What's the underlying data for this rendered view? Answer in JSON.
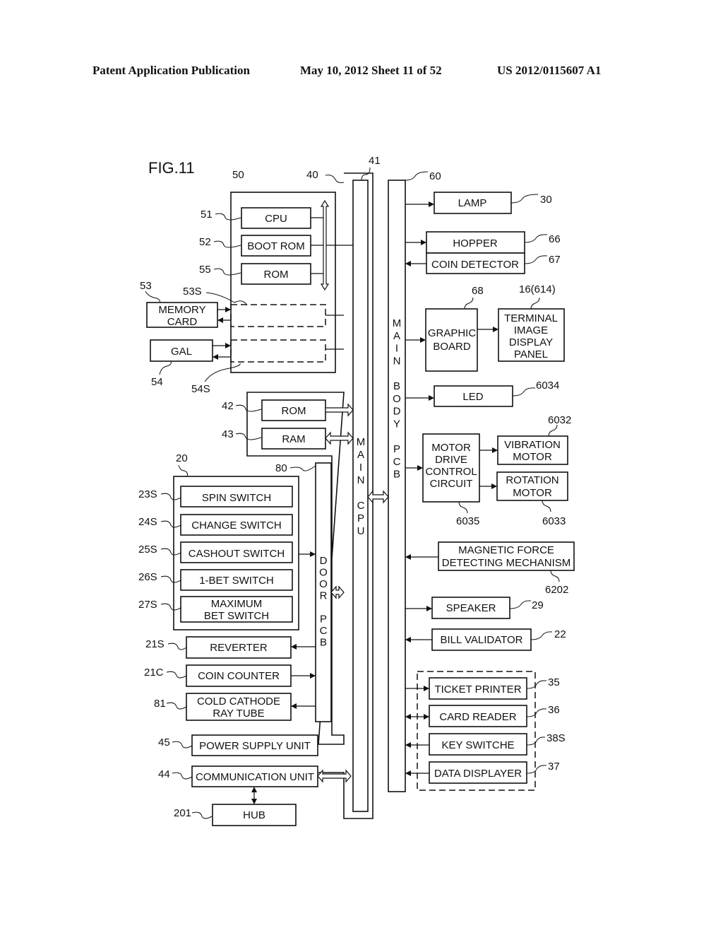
{
  "header": {
    "publication": "Patent Application Publication",
    "date_sheet": "May 10, 2012  Sheet 11 of 52",
    "number": "US 2012/0115607 A1"
  },
  "figure": {
    "title": "FIG.11",
    "refs": {
      "r50": "50",
      "r40": "40",
      "r41": "41",
      "r60": "60",
      "r51": "51",
      "r52": "52",
      "r55": "55",
      "r53": "53",
      "r53s": "53S",
      "r54": "54",
      "r54s": "54S",
      "r42": "42",
      "r43": "43",
      "r20": "20",
      "r80": "80",
      "r23s": "23S",
      "r24s": "24S",
      "r25s": "25S",
      "r26s": "26S",
      "r27s": "27S",
      "r21s": "21S",
      "r21c": "21C",
      "r81": "81",
      "r45": "45",
      "r44": "44",
      "r201": "201",
      "r30": "30",
      "r66": "66",
      "r67": "67",
      "r68": "68",
      "r16": "16(614)",
      "r6034": "6034",
      "r6032": "6032",
      "r6035": "6035",
      "r6033": "6033",
      "r6202": "6202",
      "r29": "29",
      "r22": "22",
      "r35": "35",
      "r36": "36",
      "r38s": "38S",
      "r37": "37"
    },
    "blocks": {
      "cpu": "CPU",
      "boot_rom": "BOOT ROM",
      "sub_rom": "ROM",
      "memory_card": [
        "MEMORY",
        "CARD"
      ],
      "gal": "GAL",
      "main_rom": "ROM",
      "main_ram": "RAM",
      "spin_switch": "SPIN SWITCH",
      "change_switch": "CHANGE SWITCH",
      "cashout_switch": "CASHOUT SWITCH",
      "one_bet_switch": "1-BET SWITCH",
      "max_bet_switch": [
        "MAXIMUM",
        "BET SWITCH"
      ],
      "reverter": "REVERTER",
      "coin_counter": "COIN COUNTER",
      "cold_cathode": [
        "COLD CATHODE",
        "RAY TUBE"
      ],
      "power_supply": "POWER SUPPLY UNIT",
      "communication": "COMMUNICATION UNIT",
      "hub": "HUB",
      "lamp": "LAMP",
      "hopper": "HOPPER",
      "coin_detector": "COIN DETECTOR",
      "graphic_board": [
        "GRAPHIC",
        "BOARD"
      ],
      "terminal_display": [
        "TERMINAL",
        "IMAGE",
        "DISPLAY",
        "PANEL"
      ],
      "led": "LED",
      "motor_drive": [
        "MOTOR",
        "DRIVE",
        "CONTROL",
        "CIRCUIT"
      ],
      "vibration_motor": [
        "VIBRATION",
        "MOTOR"
      ],
      "rotation_motor": [
        "ROTATION",
        "MOTOR"
      ],
      "magnetic_force": [
        "MAGNETIC FORCE",
        "DETECTING MECHANISM"
      ],
      "speaker": "SPEAKER",
      "bill_validator": "BILL VALIDATOR",
      "ticket_printer": "TICKET PRINTER",
      "card_reader": "CARD READER",
      "key_switche": "KEY SWITCHE",
      "data_displayer": "DATA DISPLAYER"
    },
    "vertical_labels": {
      "main_cpu": [
        "M",
        "A",
        "I",
        "N",
        "",
        "C",
        "P",
        "U"
      ],
      "main_body_pcb": [
        "M",
        "A",
        "I",
        "N",
        "",
        "B",
        "O",
        "D",
        "Y",
        "",
        "P",
        "C",
        "B"
      ],
      "door_pcb": [
        "D",
        "O",
        "O",
        "R",
        "",
        "P",
        "C",
        "B"
      ]
    }
  }
}
